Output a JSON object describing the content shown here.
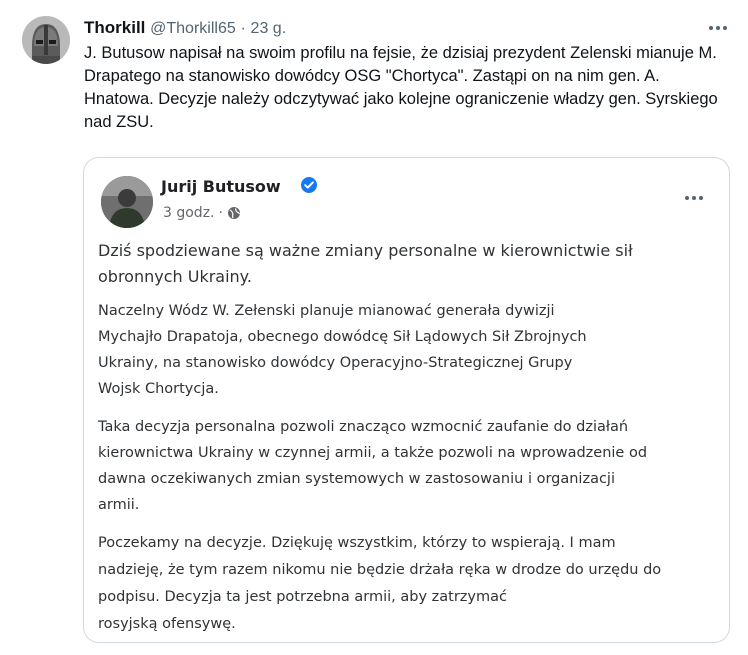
{
  "tweet": {
    "display_name": "Thorkill",
    "handle": "@Thorkill65",
    "separator": "·",
    "time": "23 g.",
    "text": "J. Butusow napisał na swoim profilu na fejsie, że dzisiaj prezydent Zelenski mianuje M. Drapatego na stanowisko dowódcy OSG \"Chortyca\". Zastąpi on na nim gen. A. Hnatowa. Decyzje należy odczytywać jako kolejne ograniczenie władzy gen. Syrskiego nad ZSU.",
    "avatar_icon": "helmet-avatar-icon",
    "more_icon": "more-horizontal-icon"
  },
  "embedded_post": {
    "author": "Jurij Butusow",
    "time": "3 godz.",
    "separator": "·",
    "verified_icon": "verified-badge-icon",
    "privacy_icon": "globe-icon",
    "paragraphs": [
      "Dziś spodziewane są ważne zmiany personalne w kierownictwie sił\nobronnych Ukrainy.",
      "Naczelny Wódz W. Zełenski planuje mianować generała dywizji\nMychajło Drapatoja, obecnego dowódcę Sił Lądowych Sił Zbrojnych\nUkrainy, na stanowisko dowódcy Operacyjno-Strategicznej Grupy\nWojsk Chortycja.",
      "Taka decyzja personalna pozwoli znacząco wzmocnić zaufanie do działań\nkierownictwa Ukrainy w czynnej armii, a także pozwoli na wprowadzenie od\ndawna oczekiwanych zmian systemowych w zastosowaniu i organizacji\narmii.",
      "Poczekamy na decyzje. Dziękuję wszystkim, którzy to wspierają. I mam\nnadzieję, że tym razem nikomu nie będzie drżała ręka w drodze do urzędu do\npodpisu. Decyzja ta jest potrzebna armii, aby zatrzymać\nrosyjską ofensywę."
    ]
  },
  "colors": {
    "accent": "#1d9bf0",
    "secondary_text": "#536471",
    "border": "#cfd9de"
  }
}
